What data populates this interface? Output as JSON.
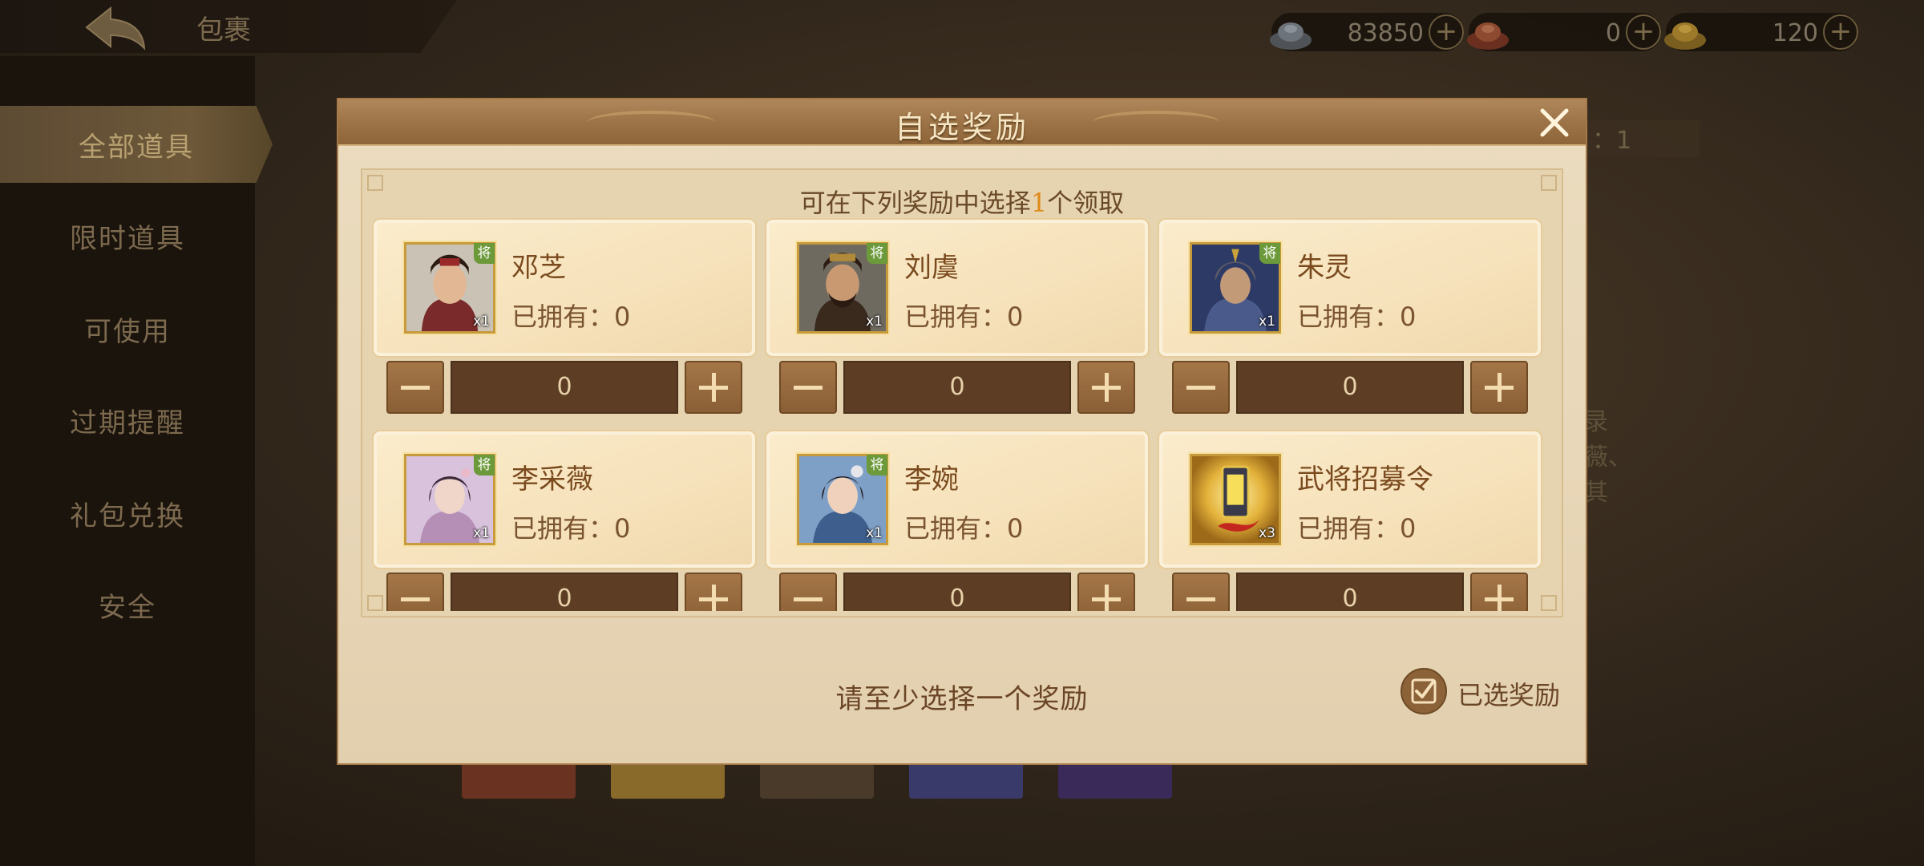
{
  "header": {
    "title": "包裹"
  },
  "resources": [
    {
      "name": "silver",
      "value": "83850",
      "icon": "silver-ingot-icon"
    },
    {
      "name": "copper",
      "value": "0",
      "icon": "copper-ingot-icon"
    },
    {
      "name": "gold",
      "value": "120",
      "icon": "gold-ingot-icon"
    }
  ],
  "sidebar": {
    "items": [
      {
        "label": "全部道具",
        "active": true
      },
      {
        "label": "限时道具"
      },
      {
        "label": "可使用"
      },
      {
        "label": "过期提醒"
      },
      {
        "label": "礼包兑换"
      },
      {
        "label": "安全"
      }
    ]
  },
  "background": {
    "count_text": "：1",
    "side_text": [
      "录",
      "薇、",
      "其"
    ]
  },
  "modal": {
    "title": "自选奖励",
    "instruction_prefix": "可在下列奖励中选择",
    "instruction_count": "1",
    "instruction_suffix": "个领取",
    "hint": "请至少选择一个奖励",
    "selected_label": "已选奖励",
    "owned_prefix": "已拥有：",
    "rewards": [
      {
        "name": "邓芝",
        "owned": "0",
        "qty": "x1",
        "badge": "将",
        "selected": "0",
        "theme": "#8a3b3b"
      },
      {
        "name": "刘虞",
        "owned": "0",
        "qty": "x1",
        "badge": "将",
        "selected": "0",
        "theme": "#4a3a2e"
      },
      {
        "name": "朱灵",
        "owned": "0",
        "qty": "x1",
        "badge": "将",
        "selected": "0",
        "theme": "#3a4a7a"
      },
      {
        "name": "李采薇",
        "owned": "0",
        "qty": "x1",
        "badge": "将",
        "selected": "0",
        "theme": "#c9a8c8"
      },
      {
        "name": "李婉",
        "owned": "0",
        "qty": "x1",
        "badge": "将",
        "selected": "0",
        "theme": "#5a7aa8"
      },
      {
        "name": "武将招募令",
        "owned": "0",
        "qty": "x3",
        "badge": "",
        "selected": "0",
        "theme": "#c9982e"
      }
    ]
  },
  "colors": {
    "accent_orange": "#e08a1a",
    "title_text": "#f7e6c4",
    "body_text": "#7a4a1e",
    "general_badge": "#6c9a3a"
  }
}
